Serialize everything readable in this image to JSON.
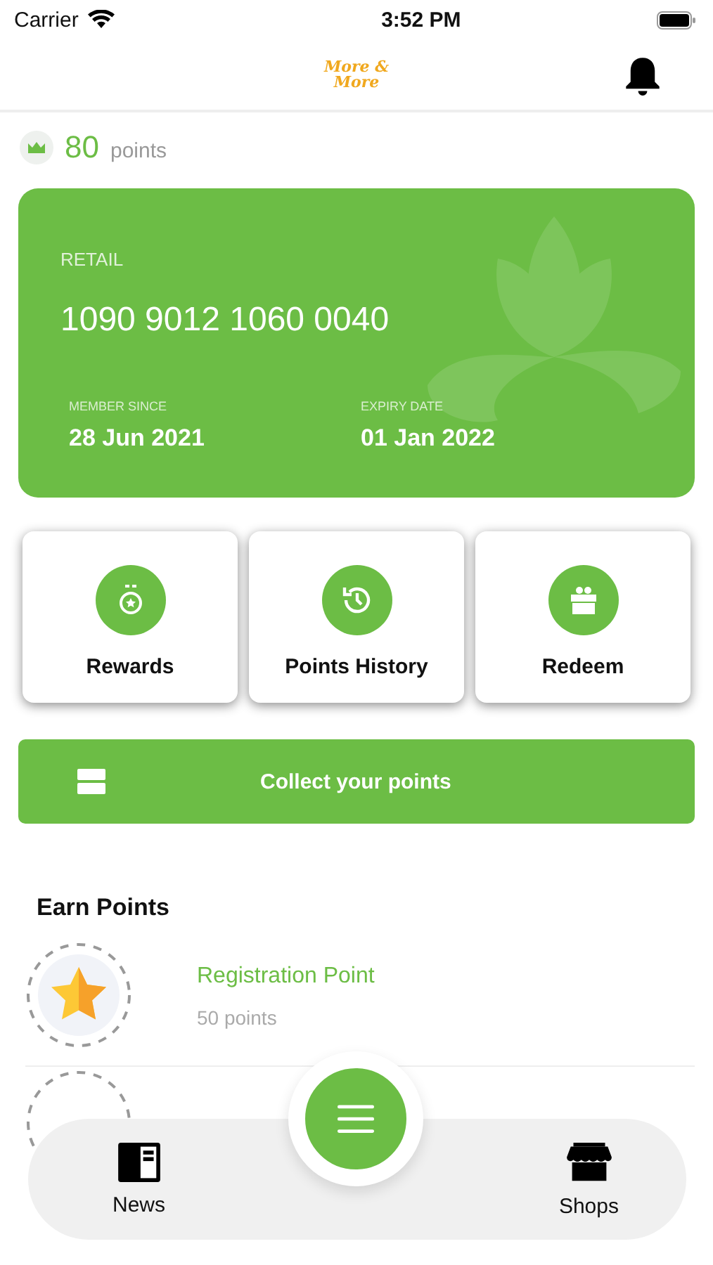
{
  "status_bar": {
    "carrier": "Carrier",
    "time": "3:52 PM"
  },
  "header": {
    "logo": "More & More"
  },
  "points": {
    "value": "80",
    "unit": "points"
  },
  "card": {
    "tier": "RETAIL",
    "number": "1090 9012 1060 0040",
    "member_since_label": "MEMBER SINCE",
    "member_since": "28 Jun 2021",
    "expiry_label": "EXPIRY DATE",
    "expiry": "01 Jan 2022"
  },
  "actions": [
    {
      "kind": "medal",
      "label": "Rewards"
    },
    {
      "kind": "history",
      "label": "Points History"
    },
    {
      "kind": "gift",
      "label": "Redeem"
    }
  ],
  "collect_button": {
    "label": "Collect your points"
  },
  "earn_points": {
    "title": "Earn Points",
    "items": [
      {
        "title": "Registration Point",
        "points": "50 points"
      }
    ]
  },
  "bottom_nav": {
    "items": [
      {
        "kind": "news",
        "label": "News"
      },
      {
        "kind": "shops",
        "label": "Shops"
      }
    ]
  }
}
